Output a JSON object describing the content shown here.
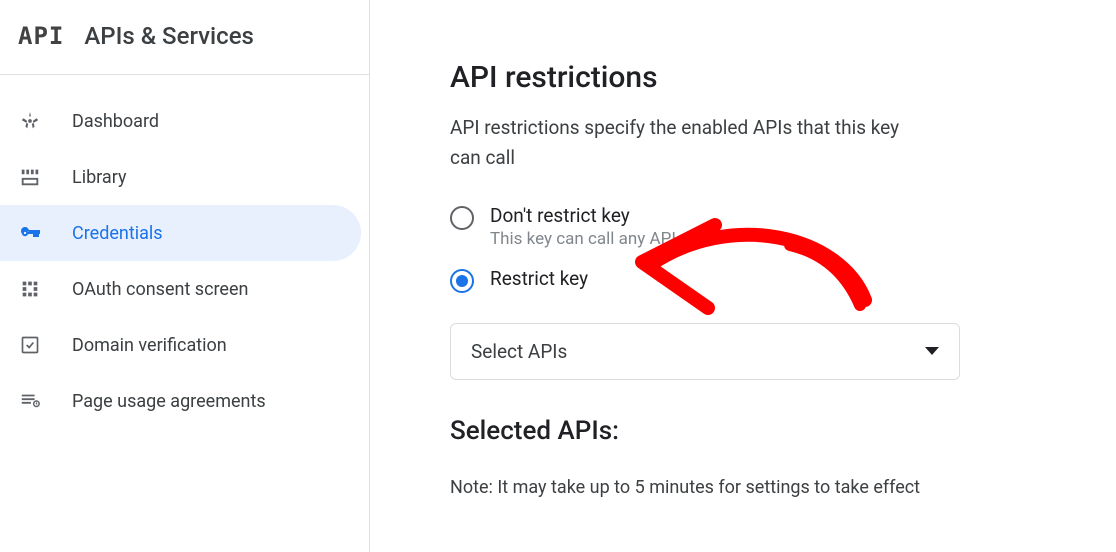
{
  "sidebar": {
    "logo": "API",
    "title": "APIs & Services",
    "items": [
      {
        "label": "Dashboard",
        "icon": "dashboard-icon",
        "active": false
      },
      {
        "label": "Library",
        "icon": "library-icon",
        "active": false
      },
      {
        "label": "Credentials",
        "icon": "key-icon",
        "active": true
      },
      {
        "label": "OAuth consent screen",
        "icon": "consent-icon",
        "active": false
      },
      {
        "label": "Domain verification",
        "icon": "checkbox-icon",
        "active": false
      },
      {
        "label": "Page usage agreements",
        "icon": "agreements-icon",
        "active": false
      }
    ]
  },
  "main": {
    "section_title": "API restrictions",
    "section_desc": "API restrictions specify the enabled APIs that this key can call",
    "radio_options": [
      {
        "label": "Don't restrict key",
        "sub": "This key can call any API",
        "checked": false
      },
      {
        "label": "Restrict key",
        "sub": "",
        "checked": true
      }
    ],
    "select_label": "Select APIs",
    "subsection_title": "Selected APIs:",
    "note": "Note: It may take up to 5 minutes for settings to take effect"
  },
  "annotation": {
    "color": "#ff0000"
  }
}
